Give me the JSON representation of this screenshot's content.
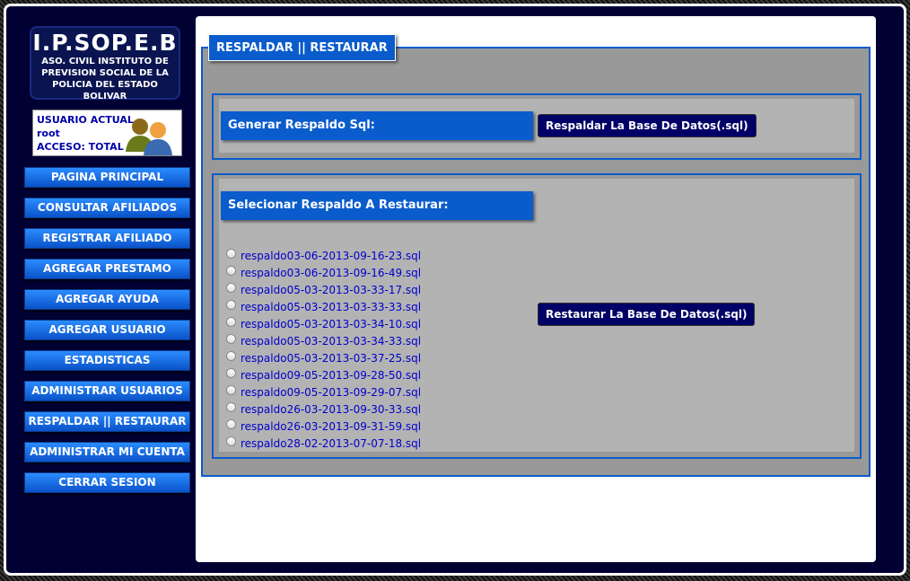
{
  "logo": {
    "title": "I.P.SOP.E.B",
    "line1": "ASO. CIVIL INSTITUTO DE",
    "line2": "PREVISION SOCIAL DE LA",
    "line3": "POLICIA DEL ESTADO BOLIVAR"
  },
  "user": {
    "label": "USUARIO ACTUAL",
    "name": "root",
    "access": "ACCESO: TOTAL"
  },
  "menu": [
    "PAGINA PRINCIPAL",
    "CONSULTAR AFILIADOS",
    "REGISTRAR AFILIADO",
    "AGREGAR PRESTAMO",
    "AGREGAR AYUDA",
    "AGREGAR USUARIO",
    "ESTADISTICAS",
    "ADMINISTRAR USUARIOS",
    "RESPALDAR || RESTAURAR",
    "ADMINISTRAR MI CUENTA",
    "CERRAR SESION"
  ],
  "main": {
    "legend": "RESPALDAR || RESTAURAR",
    "backup_label": "Generar Respaldo Sql:",
    "backup_button": "Respaldar La Base De Datos(.sql)",
    "restore_label": "Selecionar Respaldo A Restaurar:",
    "restore_button": "Restaurar La Base De Datos(.sql)",
    "files": [
      "respaldo03-06-2013-09-16-23.sql",
      "respaldo03-06-2013-09-16-49.sql",
      "respaldo05-03-2013-03-33-17.sql",
      "respaldo05-03-2013-03-33-33.sql",
      "respaldo05-03-2013-03-34-10.sql",
      "respaldo05-03-2013-03-34-33.sql",
      "respaldo05-03-2013-03-37-25.sql",
      "respaldo09-05-2013-09-28-50.sql",
      "respaldo09-05-2013-09-29-07.sql",
      "respaldo26-03-2013-09-30-33.sql",
      "respaldo26-03-2013-09-31-59.sql",
      "respaldo28-02-2013-07-07-18.sql"
    ]
  },
  "colors": {
    "page_bg": "#000033",
    "accent": "#0a5ccc",
    "button_dark": "#000066"
  }
}
